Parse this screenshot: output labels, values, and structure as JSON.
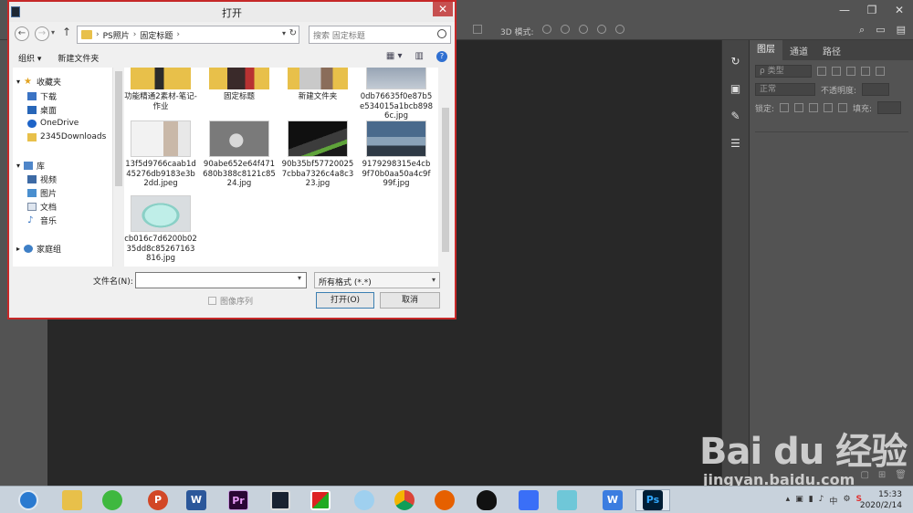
{
  "photoshop": {
    "options_3d_label": "3D 模式:",
    "panel_tabs": [
      "图层",
      "通道",
      "路径"
    ],
    "kind_filter": "ρ 类型",
    "blend_mode": "正常",
    "opacity_label": "不透明度:",
    "lock_label": "锁定:",
    "fill_label": "填充:"
  },
  "watermark": {
    "logo": "Bai du 经验",
    "url": "jingyan.baidu.com"
  },
  "dialog": {
    "title": "打开",
    "close_label": "✕",
    "breadcrumb": [
      "PS照片",
      "固定标题"
    ],
    "search_placeholder": "搜索 固定标题",
    "organize_label": "组织 ▾",
    "new_folder_label": "新建文件夹",
    "nav": {
      "favorites": "收藏夹",
      "downloads": "下载",
      "desktop": "桌面",
      "onedrive": "OneDrive",
      "downloads2345": "2345Downloads",
      "libraries": "库",
      "videos": "视频",
      "pictures": "图片",
      "documents": "文档",
      "music": "音乐",
      "homegroup": "家庭组"
    },
    "files": [
      "功能精通2素材-笔记-作业",
      "固定标题",
      "新建文件夹",
      "0db76635f0e87b5e534015a1bcb8986c.jpg",
      "13f5d9766caab1d45276db9183e3b2dd.jpeg",
      "90abe652e64f471680b388c8121c8524.jpg",
      "90b35bf577200257cbba7326c4a8c323.jpg",
      "9179298315e4cb9f70b0aa50a4c9f99f.jpg",
      "cb016c7d6200b0235dd8c85267163816.jpg"
    ],
    "filename_label": "文件名(N):",
    "filename_value": "",
    "filter_value": "所有格式 (*.*)",
    "preview_label": "图像序列",
    "open_label": "打开(O)",
    "cancel_label": "取消"
  },
  "taskbar": {
    "apps": [
      "browser",
      "file-explorer",
      "wechat",
      "powerpoint",
      "word",
      "premiere",
      "video-editor",
      "picture-app",
      "qq-browser",
      "chrome",
      "firefox",
      "qq",
      "feishu",
      "notes",
      "wps",
      "photoshop"
    ],
    "app_letters": [
      "",
      "",
      "",
      "P",
      "W",
      "Pr",
      "",
      "",
      "",
      "",
      "",
      "",
      "",
      "",
      "W",
      "Ps"
    ],
    "tray_text": "S",
    "time": "15:33",
    "date": "2020/2/14"
  },
  "colors": {
    "dialog_border": "#c62828",
    "ps_bg": "#282828",
    "ps_panel": "#535353",
    "taskbar": "#c8d2dc"
  }
}
